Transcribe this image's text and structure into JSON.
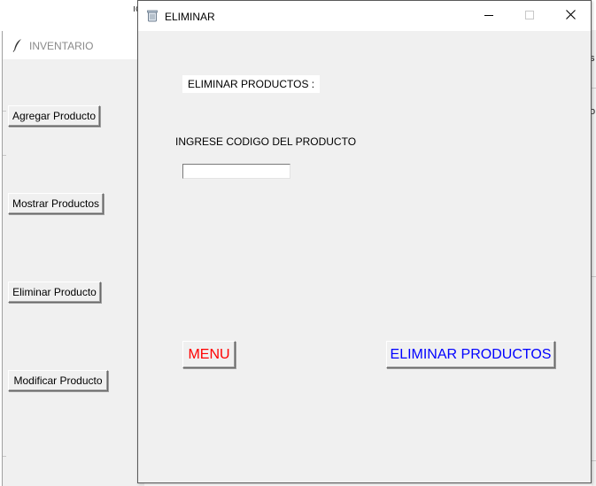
{
  "background": {
    "menu_fragment": "ıcıp",
    "right_edge_text_1": "s",
    "right_edge_text_2": "o"
  },
  "inventario_window": {
    "title": "INVENTARIO",
    "buttons": [
      {
        "label": "Agregar Producto"
      },
      {
        "label": "Mostrar Productos"
      },
      {
        "label": "Eliminar Producto"
      },
      {
        "label": "Modificar Producto"
      }
    ]
  },
  "eliminar_window": {
    "title": "ELIMINAR",
    "heading": "ELIMINAR PRODUCTOS :",
    "codigo_label": "INGRESE CODIGO DEL PRODUCTO",
    "codigo_value": "",
    "menu_button": "MENU",
    "eliminar_button": "ELIMINAR PRODUCTOS",
    "menu_color": "#ff0000",
    "eliminar_color": "#0000ff",
    "icons": {
      "window": "recycle-bin-icon",
      "minimize": "minimize-icon",
      "maximize": "maximize-icon",
      "close": "close-icon"
    }
  },
  "colors": {
    "window_bg": "#f0f0f0",
    "titlebar_bg": "#ffffff",
    "inactive_title": "#8a8a8a"
  }
}
